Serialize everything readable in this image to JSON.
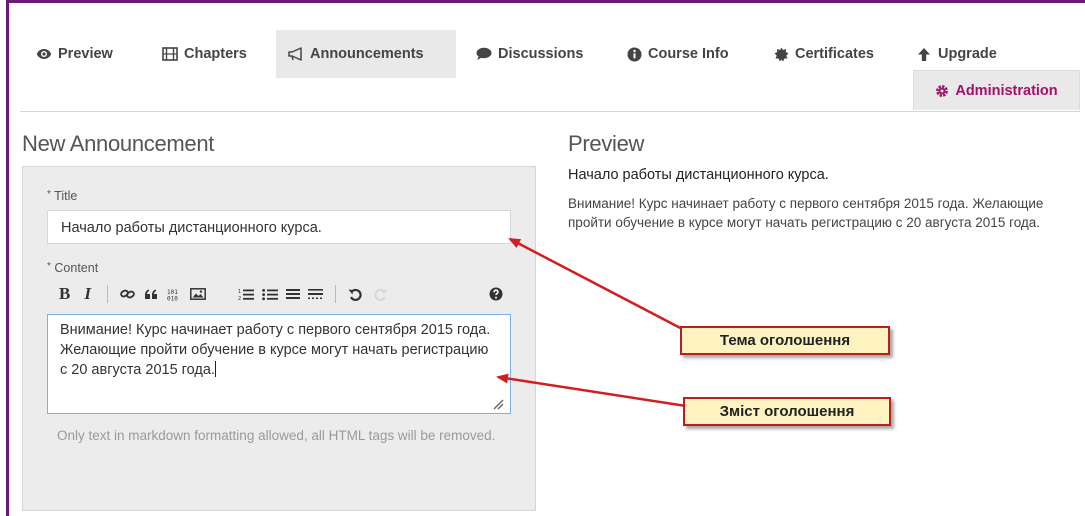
{
  "tabs": [
    {
      "label": "Preview",
      "icon": "eye-icon"
    },
    {
      "label": "Chapters",
      "icon": "film-icon"
    },
    {
      "label": "Announcements",
      "icon": "bullhorn-icon"
    },
    {
      "label": "Discussions",
      "icon": "comment-icon"
    },
    {
      "label": "Course Info",
      "icon": "info-circle-icon"
    },
    {
      "label": "Certificates",
      "icon": "certificate-icon"
    },
    {
      "label": "Upgrade",
      "icon": "arrow-up-icon"
    }
  ],
  "admin_tab": {
    "label": "Administration",
    "icon": "cog-icon",
    "color": "#a3106b"
  },
  "active_tab": "Announcements",
  "form": {
    "heading": "New Announcement",
    "title_label": "Title",
    "title_value": "Начало работы дистанционного курса.",
    "content_label": "Content",
    "required_marker": "*",
    "toolbar": {
      "bold": "B",
      "italic": "I",
      "buttons": [
        "link-icon",
        "quote-icon",
        "code-icon",
        "image-icon",
        "ordered-list-icon",
        "unordered-list-icon",
        "heading-icon",
        "horizontal-rule-icon",
        "undo-icon",
        "redo-icon",
        "help-icon"
      ]
    },
    "content_value": "Внимание! Курс начинает работу с первого сентября 2015 года. Желающие пройти обучение в курсе могут начать регистрацию с 20 августа 2015  года.",
    "help_text": "Only text in markdown formatting allowed, all HTML tags will be removed."
  },
  "preview": {
    "heading": "Preview",
    "title": "Начало работы дистанционного курса.",
    "body": "Внимание! Курс начинает работу с первого сентября 2015 года. Желающие пройти обучение в курсе могут начать регистрацию с 20 августа 2015 года."
  },
  "callouts": {
    "title_note": "Тема оголошення",
    "content_note": "Зміст оголошення"
  },
  "colors": {
    "frame_border": "#6a1b7a",
    "admin_text": "#a3106b",
    "callout_bg": "#fcf3c0",
    "callout_border": "#b82020",
    "arrow": "#d41e1e",
    "editor_focus": "#7db3e0"
  }
}
